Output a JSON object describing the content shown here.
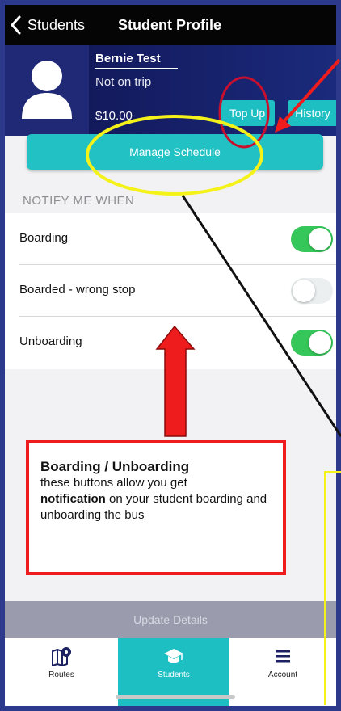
{
  "nav": {
    "back_label": "Students",
    "title": "Student Profile"
  },
  "profile": {
    "name": "Bernie Test",
    "status": "Not on trip",
    "balance": "$10.00",
    "top_up_label": "Top Up",
    "history_label": "History"
  },
  "schedule_button": "Manage Schedule",
  "notify": {
    "heading": "NOTIFY ME WHEN",
    "rows": [
      {
        "label": "Boarding",
        "on": true
      },
      {
        "label": "Boarded - wrong stop",
        "on": false
      },
      {
        "label": "Unboarding",
        "on": true
      }
    ]
  },
  "update_button": "Update Details",
  "tabs": [
    {
      "label": "Routes",
      "icon": "map-icon"
    },
    {
      "label": "Students",
      "icon": "graduation-cap-icon",
      "active": true
    },
    {
      "label": "Account",
      "icon": "menu-icon"
    }
  ],
  "callout": {
    "title": "Boarding  / Unboarding",
    "line1": " these buttons allow you get",
    "bold": "notification",
    "line2": " on your student boarding and unboarding the bus"
  },
  "colors": {
    "accent": "#1dbfc2",
    "header": "#14195a",
    "toggle_on": "#35c759",
    "annotation_red": "#ee1c1c",
    "annotation_yellow": "#f5f21a"
  }
}
